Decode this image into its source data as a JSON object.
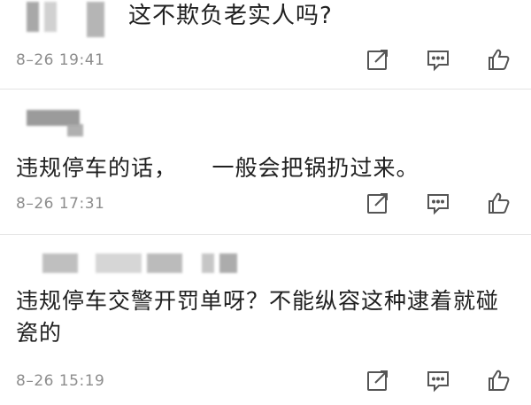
{
  "comments": [
    {
      "text": "这不欺负老实人吗?",
      "time": "8–26 19:41"
    },
    {
      "text": "违规停车的话，　　一般会把锅扔过来。",
      "time": "8–26 17:31"
    },
    {
      "text": "违规停车交警开罚单呀？不能纵容这种逮着就碰瓷的",
      "time": "8–26 15:19"
    }
  ],
  "icons": {
    "share": "share-icon",
    "reply": "comment-icon",
    "like": "thumbs-up-icon"
  },
  "colors": {
    "text": "#202020",
    "meta": "#8d8d8d",
    "icon": "#555555",
    "divider": "#e4e4e4"
  }
}
